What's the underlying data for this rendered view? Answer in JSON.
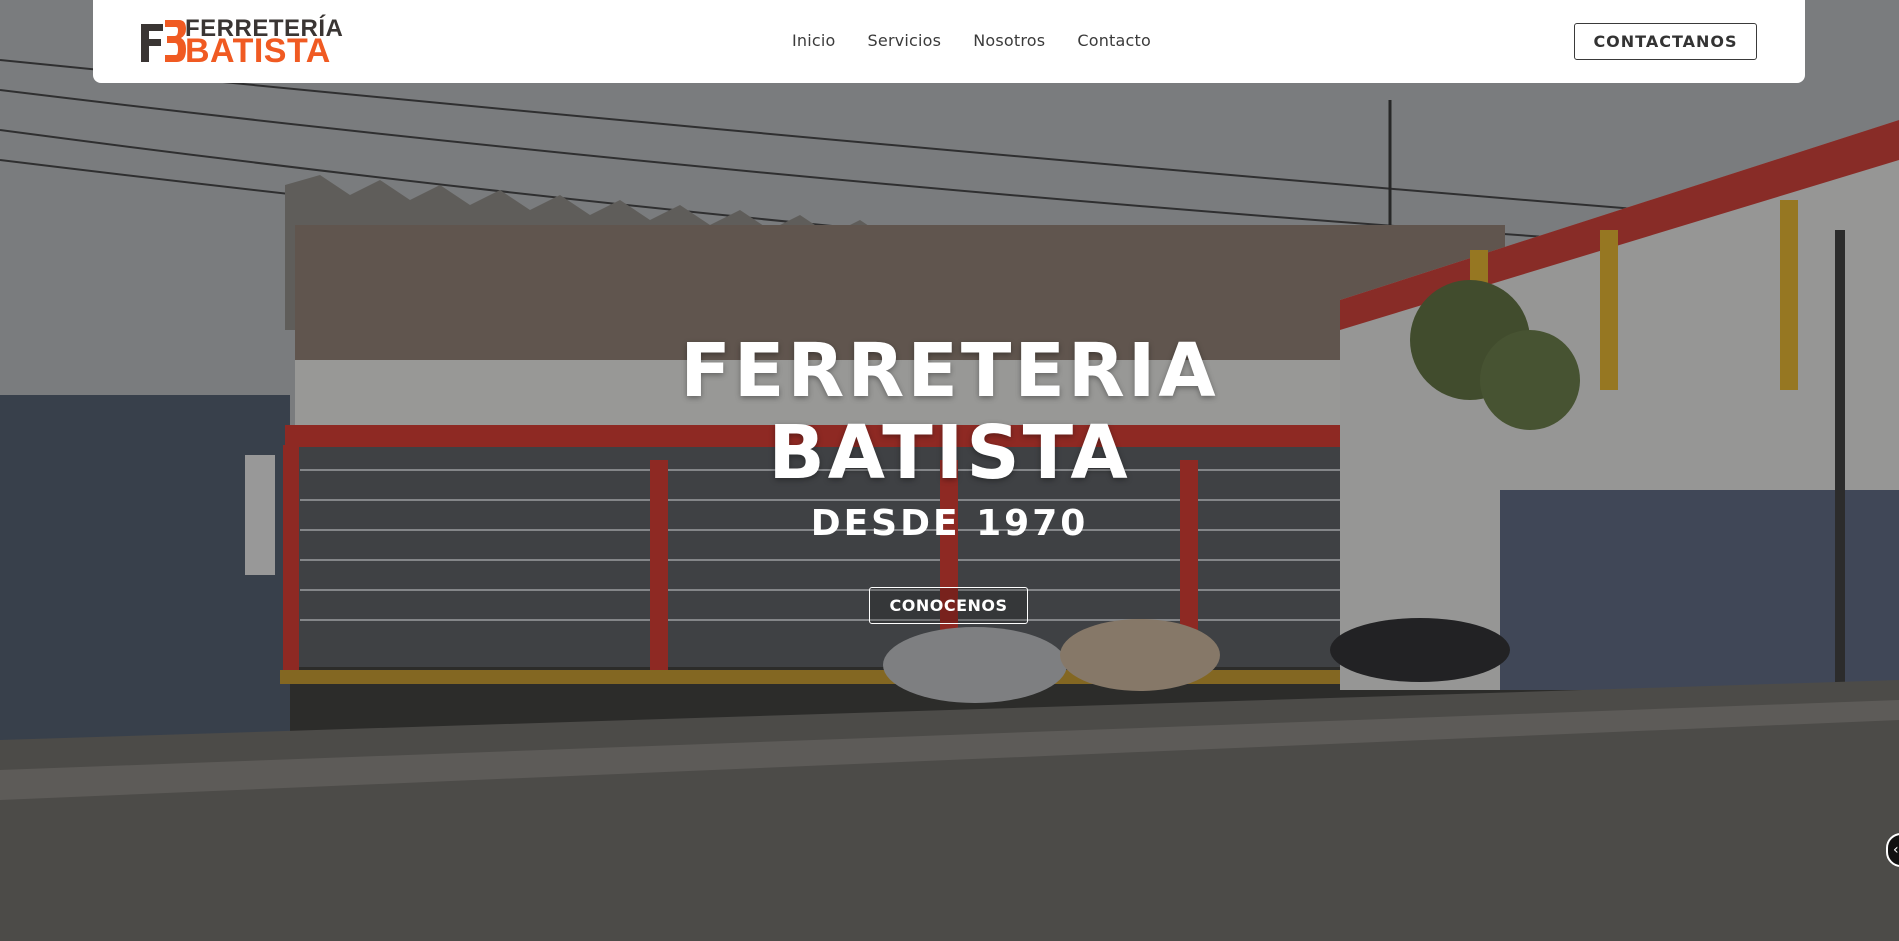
{
  "brand": {
    "name_top": "FERRETERÍA",
    "name_bottom": "BATISTA",
    "colors": {
      "orange": "#f05a22",
      "dark": "#3a3533"
    }
  },
  "nav": {
    "items": [
      {
        "label": "Inicio"
      },
      {
        "label": "Servicios"
      },
      {
        "label": "Nosotros"
      },
      {
        "label": "Contacto"
      }
    ],
    "cta_label": "CONTACTANOS"
  },
  "hero": {
    "title_line1": "FERRETERIA",
    "title_line2": "BATISTA",
    "subtitle": "DESDE 1970",
    "button_label": "CONOCENOS",
    "background": "store-front-photo",
    "next_icon": "chevron-left-icon"
  }
}
